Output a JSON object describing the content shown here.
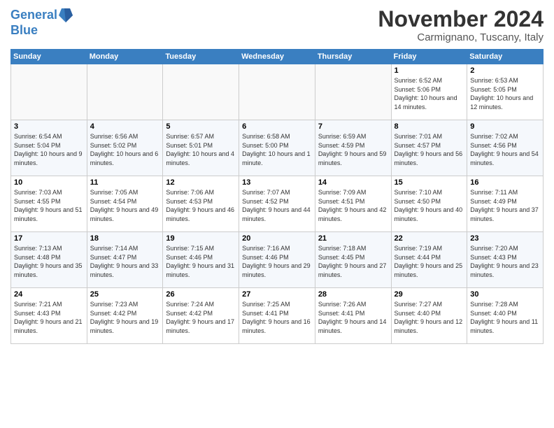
{
  "logo": {
    "line1": "General",
    "line2": "Blue"
  },
  "title": "November 2024",
  "subtitle": "Carmignano, Tuscany, Italy",
  "headers": [
    "Sunday",
    "Monday",
    "Tuesday",
    "Wednesday",
    "Thursday",
    "Friday",
    "Saturday"
  ],
  "weeks": [
    [
      {
        "day": "",
        "info": ""
      },
      {
        "day": "",
        "info": ""
      },
      {
        "day": "",
        "info": ""
      },
      {
        "day": "",
        "info": ""
      },
      {
        "day": "",
        "info": ""
      },
      {
        "day": "1",
        "info": "Sunrise: 6:52 AM\nSunset: 5:06 PM\nDaylight: 10 hours and 14 minutes."
      },
      {
        "day": "2",
        "info": "Sunrise: 6:53 AM\nSunset: 5:05 PM\nDaylight: 10 hours and 12 minutes."
      }
    ],
    [
      {
        "day": "3",
        "info": "Sunrise: 6:54 AM\nSunset: 5:04 PM\nDaylight: 10 hours and 9 minutes."
      },
      {
        "day": "4",
        "info": "Sunrise: 6:56 AM\nSunset: 5:02 PM\nDaylight: 10 hours and 6 minutes."
      },
      {
        "day": "5",
        "info": "Sunrise: 6:57 AM\nSunset: 5:01 PM\nDaylight: 10 hours and 4 minutes."
      },
      {
        "day": "6",
        "info": "Sunrise: 6:58 AM\nSunset: 5:00 PM\nDaylight: 10 hours and 1 minute."
      },
      {
        "day": "7",
        "info": "Sunrise: 6:59 AM\nSunset: 4:59 PM\nDaylight: 9 hours and 59 minutes."
      },
      {
        "day": "8",
        "info": "Sunrise: 7:01 AM\nSunset: 4:57 PM\nDaylight: 9 hours and 56 minutes."
      },
      {
        "day": "9",
        "info": "Sunrise: 7:02 AM\nSunset: 4:56 PM\nDaylight: 9 hours and 54 minutes."
      }
    ],
    [
      {
        "day": "10",
        "info": "Sunrise: 7:03 AM\nSunset: 4:55 PM\nDaylight: 9 hours and 51 minutes."
      },
      {
        "day": "11",
        "info": "Sunrise: 7:05 AM\nSunset: 4:54 PM\nDaylight: 9 hours and 49 minutes."
      },
      {
        "day": "12",
        "info": "Sunrise: 7:06 AM\nSunset: 4:53 PM\nDaylight: 9 hours and 46 minutes."
      },
      {
        "day": "13",
        "info": "Sunrise: 7:07 AM\nSunset: 4:52 PM\nDaylight: 9 hours and 44 minutes."
      },
      {
        "day": "14",
        "info": "Sunrise: 7:09 AM\nSunset: 4:51 PM\nDaylight: 9 hours and 42 minutes."
      },
      {
        "day": "15",
        "info": "Sunrise: 7:10 AM\nSunset: 4:50 PM\nDaylight: 9 hours and 40 minutes."
      },
      {
        "day": "16",
        "info": "Sunrise: 7:11 AM\nSunset: 4:49 PM\nDaylight: 9 hours and 37 minutes."
      }
    ],
    [
      {
        "day": "17",
        "info": "Sunrise: 7:13 AM\nSunset: 4:48 PM\nDaylight: 9 hours and 35 minutes."
      },
      {
        "day": "18",
        "info": "Sunrise: 7:14 AM\nSunset: 4:47 PM\nDaylight: 9 hours and 33 minutes."
      },
      {
        "day": "19",
        "info": "Sunrise: 7:15 AM\nSunset: 4:46 PM\nDaylight: 9 hours and 31 minutes."
      },
      {
        "day": "20",
        "info": "Sunrise: 7:16 AM\nSunset: 4:46 PM\nDaylight: 9 hours and 29 minutes."
      },
      {
        "day": "21",
        "info": "Sunrise: 7:18 AM\nSunset: 4:45 PM\nDaylight: 9 hours and 27 minutes."
      },
      {
        "day": "22",
        "info": "Sunrise: 7:19 AM\nSunset: 4:44 PM\nDaylight: 9 hours and 25 minutes."
      },
      {
        "day": "23",
        "info": "Sunrise: 7:20 AM\nSunset: 4:43 PM\nDaylight: 9 hours and 23 minutes."
      }
    ],
    [
      {
        "day": "24",
        "info": "Sunrise: 7:21 AM\nSunset: 4:43 PM\nDaylight: 9 hours and 21 minutes."
      },
      {
        "day": "25",
        "info": "Sunrise: 7:23 AM\nSunset: 4:42 PM\nDaylight: 9 hours and 19 minutes."
      },
      {
        "day": "26",
        "info": "Sunrise: 7:24 AM\nSunset: 4:42 PM\nDaylight: 9 hours and 17 minutes."
      },
      {
        "day": "27",
        "info": "Sunrise: 7:25 AM\nSunset: 4:41 PM\nDaylight: 9 hours and 16 minutes."
      },
      {
        "day": "28",
        "info": "Sunrise: 7:26 AM\nSunset: 4:41 PM\nDaylight: 9 hours and 14 minutes."
      },
      {
        "day": "29",
        "info": "Sunrise: 7:27 AM\nSunset: 4:40 PM\nDaylight: 9 hours and 12 minutes."
      },
      {
        "day": "30",
        "info": "Sunrise: 7:28 AM\nSunset: 4:40 PM\nDaylight: 9 hours and 11 minutes."
      }
    ]
  ]
}
